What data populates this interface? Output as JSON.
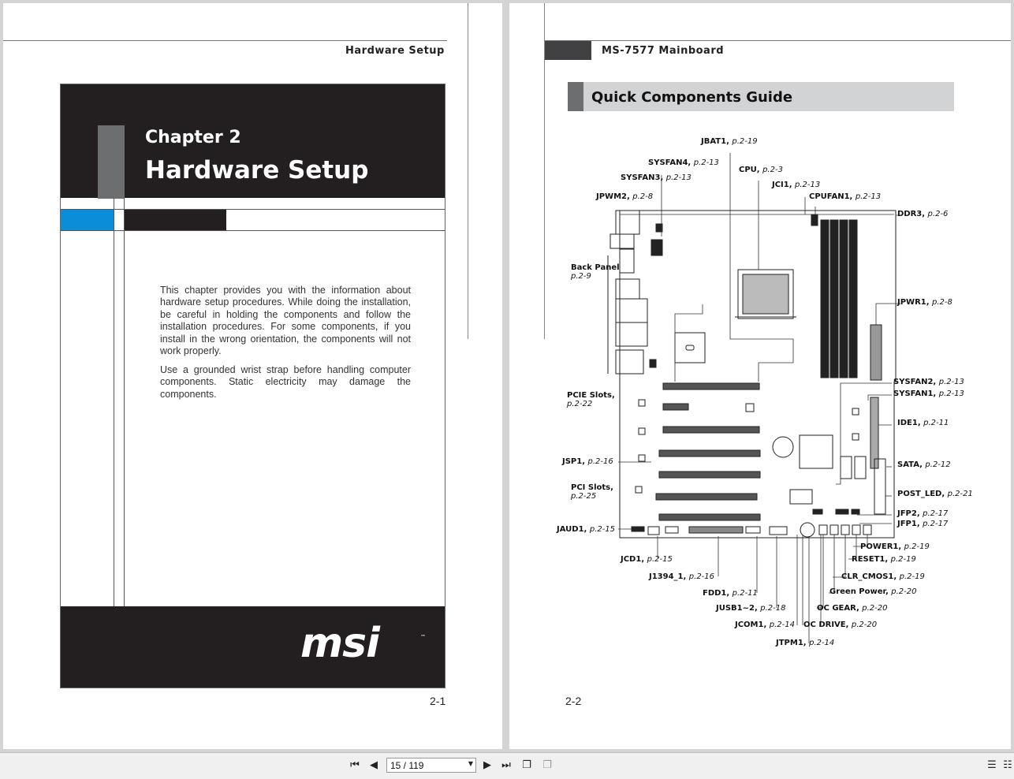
{
  "left_page": {
    "header": "Hardware Setup",
    "chapter": "Chapter 2",
    "title": "Hardware Setup",
    "para1": "This chapter provides you with the information about hardware setup procedures. While doing the installation, be careful in holding the components and follow the installation procedures. For some components, if you install in the wrong orientation, the components will not work properly.",
    "para2": "Use a grounded wrist strap before handling computer components. Static electricity may damage the components.",
    "logo": "msi",
    "logo_tm": "™",
    "page_number": "2-1"
  },
  "right_page": {
    "header": "MS-7577 Mainboard",
    "section_title": "Quick Components Guide",
    "page_number": "2-2",
    "labels": [
      {
        "name": "JBAT1",
        "page": "p.2-19"
      },
      {
        "name": "SYSFAN4",
        "page": "p.2-13"
      },
      {
        "name": "CPU",
        "page": "p.2-3"
      },
      {
        "name": "SYSFAN3",
        "page": "p.2-13"
      },
      {
        "name": "JCI1",
        "page": "p.2-13"
      },
      {
        "name": "JPWM2",
        "page": "p.2-8"
      },
      {
        "name": "CPUFAN1",
        "page": "p.2-13"
      },
      {
        "name": "DDR3",
        "page": "p.2-6"
      },
      {
        "name": "Back Panel",
        "page": "p.2-9"
      },
      {
        "name": "JPWR1",
        "page": "p.2-8"
      },
      {
        "name": "SYSFAN2",
        "page": "p.2-13"
      },
      {
        "name": "SYSFAN1",
        "page": "p.2-13"
      },
      {
        "name": "PCIE Slots",
        "page": "p.2-22"
      },
      {
        "name": "IDE1",
        "page": "p.2-11"
      },
      {
        "name": "JSP1",
        "page": "p.2-16"
      },
      {
        "name": "SATA",
        "page": "p.2-12"
      },
      {
        "name": "PCI Slots",
        "page": "p.2-25"
      },
      {
        "name": "POST_LED",
        "page": "p.2-21"
      },
      {
        "name": "JFP2",
        "page": "p.2-17"
      },
      {
        "name": "JFP1",
        "page": "p.2-17"
      },
      {
        "name": "JAUD1",
        "page": "p.2-15"
      },
      {
        "name": "POWER1",
        "page": "p.2-19"
      },
      {
        "name": "JCD1",
        "page": "p.2-15"
      },
      {
        "name": "RESET1",
        "page": "p.2-19"
      },
      {
        "name": "J1394_1",
        "page": "p.2-16"
      },
      {
        "name": "CLR_CMOS1",
        "page": "p.2-19"
      },
      {
        "name": "FDD1",
        "page": "p.2-11"
      },
      {
        "name": "Green Power",
        "page": "p.2-20"
      },
      {
        "name": "JUSB1~2",
        "page": "p.2-18"
      },
      {
        "name": "OC GEAR",
        "page": "p.2-20"
      },
      {
        "name": "JCOM1",
        "page": "p.2-14"
      },
      {
        "name": "OC DRIVE",
        "page": "p.2-20"
      },
      {
        "name": "JTPM1",
        "page": "p.2-14"
      }
    ]
  },
  "toolbar": {
    "page_field": "15 / 119",
    "icons": [
      "first-page-icon",
      "prev-page-icon",
      "next-page-icon",
      "last-page-icon",
      "continuous-view-icon",
      "facing-view-icon",
      "list-icon",
      "details-icon"
    ]
  },
  "colors": {
    "dark": "#231f20",
    "gray_bar": "#6d6e70",
    "blue": "#0b8ed6",
    "guide_bg": "#d2d3d5"
  }
}
